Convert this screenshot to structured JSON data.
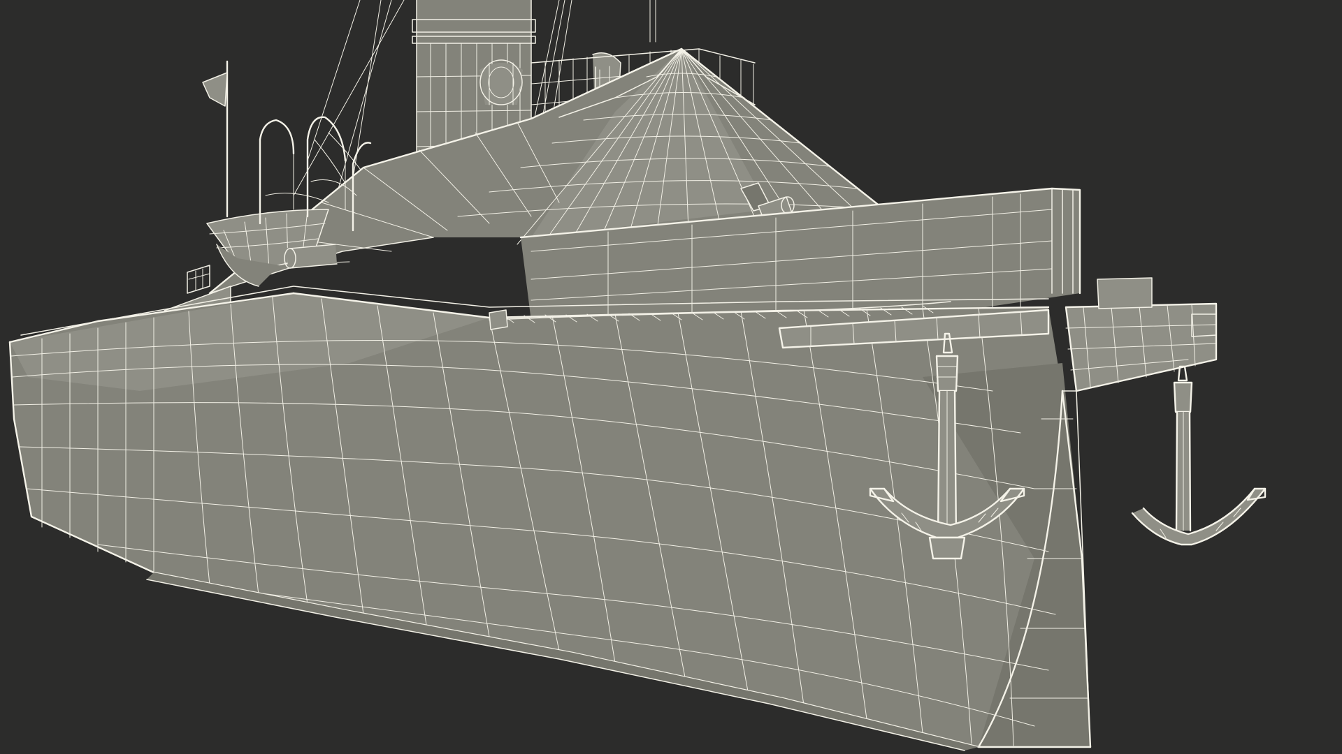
{
  "scene": {
    "subject": "ironclad-ship-wireframe-render",
    "render_style": "wireframe-over-clay",
    "colors": {
      "background": "#2c2c2b",
      "surface": "#83837a",
      "surface_dark": "#76766d",
      "surface_light": "#8f8f86",
      "wireframe": "#f2f0e6"
    },
    "icons": [
      "ship-hull",
      "casemate",
      "smokestack",
      "lifeboat",
      "anchor",
      "anchor-chain",
      "flag",
      "railing",
      "rigging"
    ]
  }
}
